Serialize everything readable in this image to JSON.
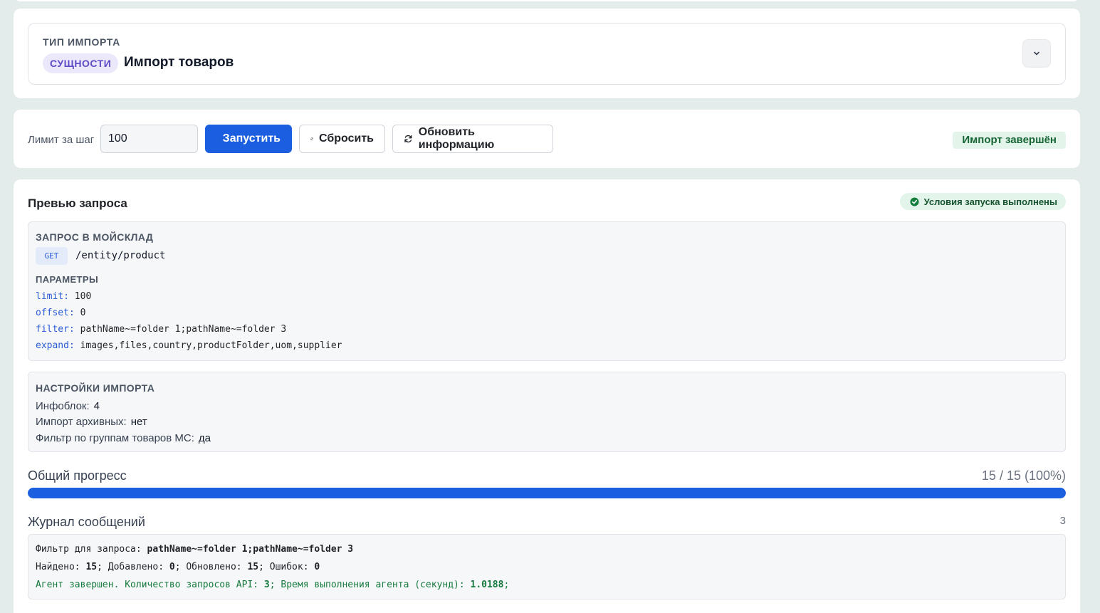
{
  "import_type": {
    "caption": "ТИП ИМПОРТА",
    "category_badge": "СУЩНОСТИ",
    "title": "Импорт товаров"
  },
  "controls": {
    "limit_label": "Лимит за шаг",
    "limit_value": "100",
    "run_label": "Запустить",
    "reset_label": "Сбросить",
    "refresh_label": "Обновить информацию",
    "status_text": "Импорт завершён"
  },
  "preview": {
    "title": "Превью запроса",
    "condition_badge": "Условия запуска выполнены",
    "request": {
      "caption": "ЗАПРОС В МОЙСКЛАД",
      "method": "GET",
      "endpoint": "/entity/product",
      "params_caption": "ПАРАМЕТРЫ",
      "params": [
        {
          "key": "limit:",
          "value": "100"
        },
        {
          "key": "offset:",
          "value": "0"
        },
        {
          "key": "filter:",
          "value": "pathName~=folder 1;pathName~=folder 3"
        },
        {
          "key": "expand:",
          "value": "images,files,country,productFolder,uom,supplier"
        }
      ]
    },
    "settings": {
      "caption": "НАСТРОЙКИ ИМПОРТА",
      "rows": [
        {
          "label": "Инфоблок:",
          "value": "4"
        },
        {
          "label": "Импорт архивных:",
          "value": "нет"
        },
        {
          "label": "Фильтр по группам товаров МС:",
          "value": "да"
        }
      ]
    }
  },
  "progress": {
    "label": "Общий прогресс",
    "count_text": "15 / 15 (100%)",
    "fraction": 1.0
  },
  "log": {
    "label": "Журнал сообщений",
    "count": "3",
    "lines": {
      "filter_label": "Фильтр для запроса:",
      "filter_value": "pathName~=folder 1;pathName~=folder 3",
      "found_label": "Найдено:",
      "found_value": "15",
      "added_label": "; Добавлено:",
      "added_value": "0",
      "updated_label": "; Обновлено:",
      "updated_value": "15",
      "errors_label": "; Ошибок:",
      "errors_value": "0",
      "agent_label": "Агент завершен. Количество запросов API:",
      "agent_requests": "3",
      "agent_time_label": "; Время выполнения агента (секунд):",
      "agent_time": "1.0188",
      "agent_end": ";"
    }
  },
  "colors": {
    "accent": "#1b5fe0",
    "success": "#166534",
    "background": "#e3eceb"
  }
}
